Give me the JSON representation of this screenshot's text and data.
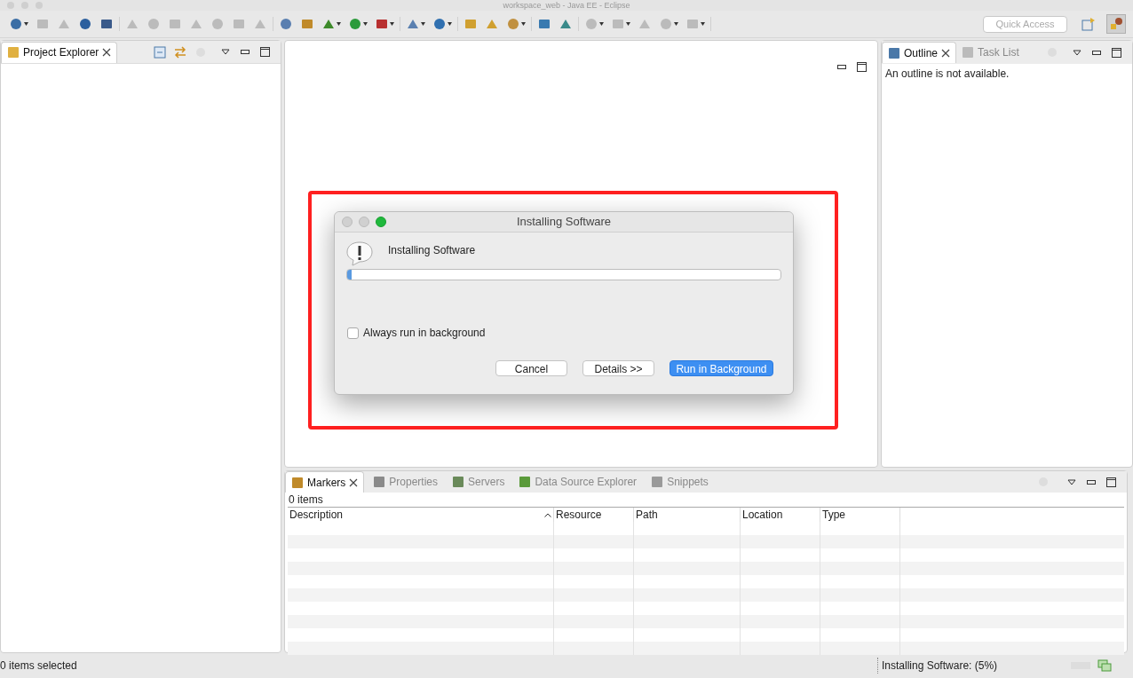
{
  "window": {
    "title": "workspace_web - Java EE - Eclipse"
  },
  "quick_access": {
    "placeholder": "Quick Access"
  },
  "project_explorer": {
    "tabs": [
      {
        "label": "Project Explorer",
        "selected": true
      }
    ]
  },
  "outline": {
    "tabs": [
      {
        "label": "Outline",
        "selected": true
      },
      {
        "label": "Task List",
        "selected": false
      }
    ],
    "message": "An outline is not available."
  },
  "bottom": {
    "tabs": [
      {
        "label": "Markers",
        "selected": true
      },
      {
        "label": "Properties",
        "selected": false
      },
      {
        "label": "Servers",
        "selected": false
      },
      {
        "label": "Data Source Explorer",
        "selected": false
      },
      {
        "label": "Snippets",
        "selected": false
      }
    ],
    "count": "0 items",
    "columns": [
      {
        "label": "Description",
        "sorted": true
      },
      {
        "label": "Resource",
        "sorted": false
      },
      {
        "label": "Path",
        "sorted": false
      },
      {
        "label": "Location",
        "sorted": false
      },
      {
        "label": "Type",
        "sorted": false
      }
    ]
  },
  "status_bar": {
    "left": "0 items selected",
    "progress": "Installing Software: (5%)"
  },
  "dialog": {
    "title": "Installing Software",
    "message": "Installing Software",
    "progress": {
      "level": 0.01
    },
    "always_background": {
      "label": "Always run in background",
      "checked": false
    },
    "buttons": [
      {
        "label": "Cancel",
        "primary": false
      },
      {
        "label": "Details >>",
        "primary": false
      },
      {
        "label": "Run in Background",
        "primary": true
      }
    ]
  }
}
